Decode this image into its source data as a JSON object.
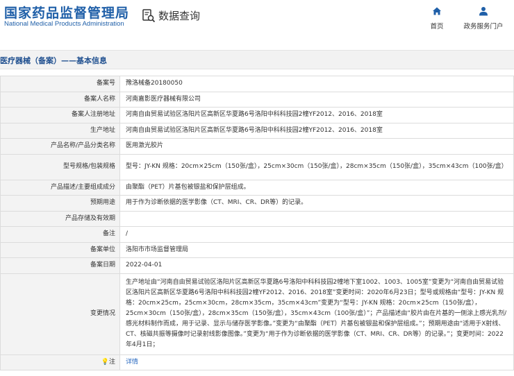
{
  "header": {
    "logo_cn": "国家药品监督管理局",
    "logo_en": "National Medical Products Administration",
    "query_title": "数据查询",
    "nav_home": "首页",
    "nav_services": "政务服务门户"
  },
  "section": {
    "title": "医疗器械（备案）——基本信息"
  },
  "rows": [
    {
      "label": "备案号",
      "value": "豫洛械备20180050"
    },
    {
      "label": "备案人名称",
      "value": "河南嘉影医疗器械有限公司"
    },
    {
      "label": "备案人注册地址",
      "value": "河南自由贸易试验区洛阳片区高新区华夏路6号洛阳中科科技园2幢YF2012、2016、2018室"
    },
    {
      "label": "生产地址",
      "value": "河南自由贸易试验区洛阳片区高新区华夏路6号洛阳中科科技园2幢YF2012、2016、2018室"
    },
    {
      "label": "产品名称/产品分类名称",
      "value": "医用激光胶片"
    },
    {
      "label": "型号规格/包装规格",
      "value": "型号：JY-KN 规格：20cm×25cm（150张/盒），25cm×30cm（150张/盒），28cm×35cm（150张/盒），35cm×43cm（100张/盒）"
    },
    {
      "label": "产品描述/主要组成成分",
      "value": "由聚酯（PET）片基包被银盐和保护层组成。"
    },
    {
      "label": "预期用途",
      "value": "用于作为诊断依据的医学影像（CT、MRI、CR、DR等）的记录。"
    },
    {
      "label": "产品存储及有效期",
      "value": ""
    },
    {
      "label": "备注",
      "value": "/"
    },
    {
      "label": "备案单位",
      "value": "洛阳市市场监督管理局"
    },
    {
      "label": "备案日期",
      "value": "2022-04-01"
    },
    {
      "label": "变更情况",
      "value": "生产地址由“河南自由贸易试验区洛阳片区高新区华夏路6号洛阳中科科技园2幢地下室1002、1003、1005室”变更为“河南自由贸易试验区洛阳片区高新区华夏路6号洛阳中科科技园2幢YF2012、2016、2018室”变更时间：2020年6月23日；型号或规格由“型号：JY-KN 规格：20cm×25cm，25cm×30cm，28cm×35cm，35cm×43cm”变更为“型号：JY-KN 规格：20cm×25cm（150张/盒），25cm×30cm（150张/盒），28cm×35cm（150张/盒），35cm×43cm（100张/盒）”；产品描述由“胶片由在片基的一侧涂上感光乳剂/感光材料制作而成，用于记录、显示与储存医学影像。”变更为“由聚酯（PET）片基包被银盐和保护层组成。”；预期用途由“适用于X射线、CT、核磁共振等摄像时记录射线影像图像。”变更为“用于作为诊断依据的医学影像（CT、MRI、CR、DR等）的记录。”；变更时间：2022年4月1日；"
    }
  ],
  "note": {
    "label": "注",
    "icon": "lightbulb-icon",
    "link": "详情"
  },
  "colors": {
    "brand_blue": "#1f5fa8",
    "link_blue": "#2a6ac0",
    "label_bg": "#f3f3f3"
  }
}
